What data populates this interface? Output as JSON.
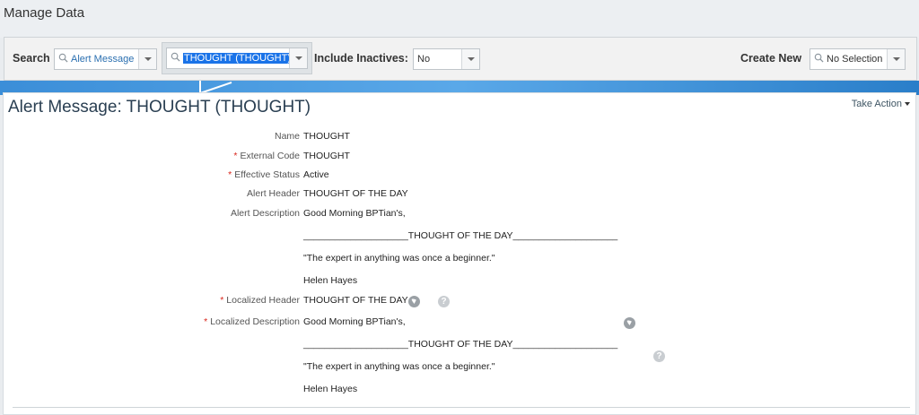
{
  "page": {
    "title": "Manage Data"
  },
  "search_bar": {
    "search_label": "Search",
    "object_type": "Alert Message",
    "search_value": "THOUGHT (THOUGHT)",
    "include_inactives_label": "Include Inactives:",
    "include_inactives_value": "No",
    "create_new_label": "Create New",
    "create_new_value": "No Selection"
  },
  "record": {
    "title": "Alert Message: THOUGHT (THOUGHT)",
    "take_action": "Take Action",
    "fields": {
      "name": {
        "label": "Name",
        "value": "THOUGHT"
      },
      "external_code": {
        "label": "External Code",
        "value": "THOUGHT"
      },
      "effective_status": {
        "label": "Effective Status",
        "value": "Active"
      },
      "alert_header": {
        "label": "Alert Header",
        "value": "THOUGHT OF THE DAY"
      },
      "alert_description": {
        "label": "Alert Description",
        "lines": [
          "Good Morning BPTian's,",
          "____________________THOUGHT OF THE DAY____________________",
          "\"The expert in anything was once a beginner.\"",
          "Helen Hayes"
        ]
      },
      "localized_header": {
        "label": "Localized Header",
        "value": "THOUGHT OF THE DAY"
      },
      "localized_description": {
        "label": "Localized Description",
        "lines": [
          "Good Morning BPTian's,",
          "____________________THOUGHT OF THE DAY____________________",
          "\"The expert in anything was once a beginner.\"",
          "Helen Hayes"
        ]
      }
    },
    "required_marker": "*",
    "help_glyph": "?"
  },
  "icons": {
    "search": "magnifier-icon",
    "dropdown": "chevron-down-icon",
    "translate": "globe-icon",
    "help": "help-icon"
  },
  "colors": {
    "accent_band": "#3b8ed8",
    "selection": "#1a73e8",
    "required": "#d9261c",
    "title": "#2a3f52"
  }
}
